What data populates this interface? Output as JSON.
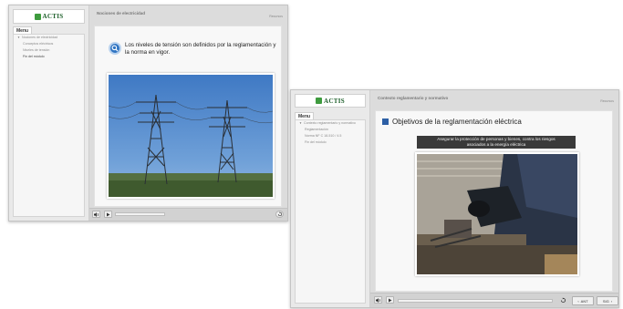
{
  "screen1": {
    "logo_text": "ACTIS",
    "menu_tab": "Menu",
    "menu_items": [
      "Nociones de electricidad",
      "Conceptos eléctricos",
      "Niveles de tensión",
      "Fin del módulo"
    ],
    "header_title": "Nociones de electricidad",
    "resources": "Recursos",
    "prompt_text": "Los niveles de tensión son definidos por la reglamentación y la norma en vigor."
  },
  "screen2": {
    "logo_text": "ACTIS",
    "menu_tab": "Menu",
    "menu_items": [
      "Contexto reglamentario y normativo",
      "Reglamentación",
      "Norma NF C 18-510 / 4.5",
      "Fin del módulo"
    ],
    "header_title": "Contexto reglamentario y normativo",
    "resources": "Recursos",
    "slide_title": "Objetivos de la reglamentación eléctrica",
    "caption_line1": "Asegurar la protección de personas y bienes, contra los riesgos",
    "caption_line2": "asociados a la energía eléctrica",
    "prev_label": "ANT",
    "next_label": "SIG"
  },
  "colors": {
    "accent_blue": "#2f74c2",
    "title_square": "#2d5fa5",
    "logo_green": "#3e9b3e"
  },
  "icons": [
    "speaker-icon",
    "play-icon",
    "replay-icon",
    "search-icon",
    "prev-arrow-icon",
    "next-arrow-icon"
  ]
}
